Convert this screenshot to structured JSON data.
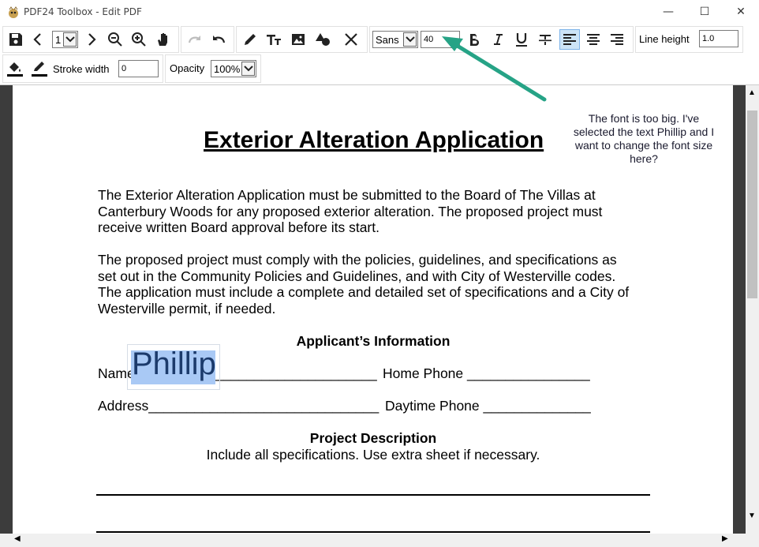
{
  "window": {
    "title": "PDF24 Toolbox - Edit PDF"
  },
  "toolbar": {
    "page_number": "1",
    "font_family": "Sans",
    "font_size": "40",
    "line_height_label": "Line height",
    "line_height_value": "1.0",
    "stroke_width_label": "Stroke width",
    "stroke_width_value": "0",
    "opacity_label": "Opacity",
    "opacity_value": "100%"
  },
  "document": {
    "title": "Exterior Alteration Application",
    "para1": [
      "The Exterior Alteration Application must be submitted to the Board of The Villas at",
      "Canterbury Woods for any proposed exterior alteration.  The proposed project must",
      "receive written Board approval before its start."
    ],
    "para2": [
      "The proposed project must comply with the policies, guidelines, and specifications as",
      "set out in the Community Policies and Guidelines, and with City of Westerville codes.",
      "The application must include a complete and detailed set of specifications and a City of",
      "Westerville permit, if needed."
    ],
    "applicant_heading": "Applicant’s Information",
    "name_label": "Name",
    "name_value": "Phillip",
    "name_line": "_______________________________",
    "home_phone": "Home Phone ________________",
    "address_line": "Address______________________________",
    "daytime_phone": "Daytime Phone ______________",
    "project_heading": "Project Description",
    "project_sub": "Include all specifications.  Use extra sheet if necessary."
  },
  "annotation": {
    "text": "The font is too big. I've selected the text Phillip and I want to change the font size here?"
  },
  "colors": {
    "accent": "#26a386",
    "selection": "#a9c9f5",
    "selected_text": "#1b3a6b"
  }
}
